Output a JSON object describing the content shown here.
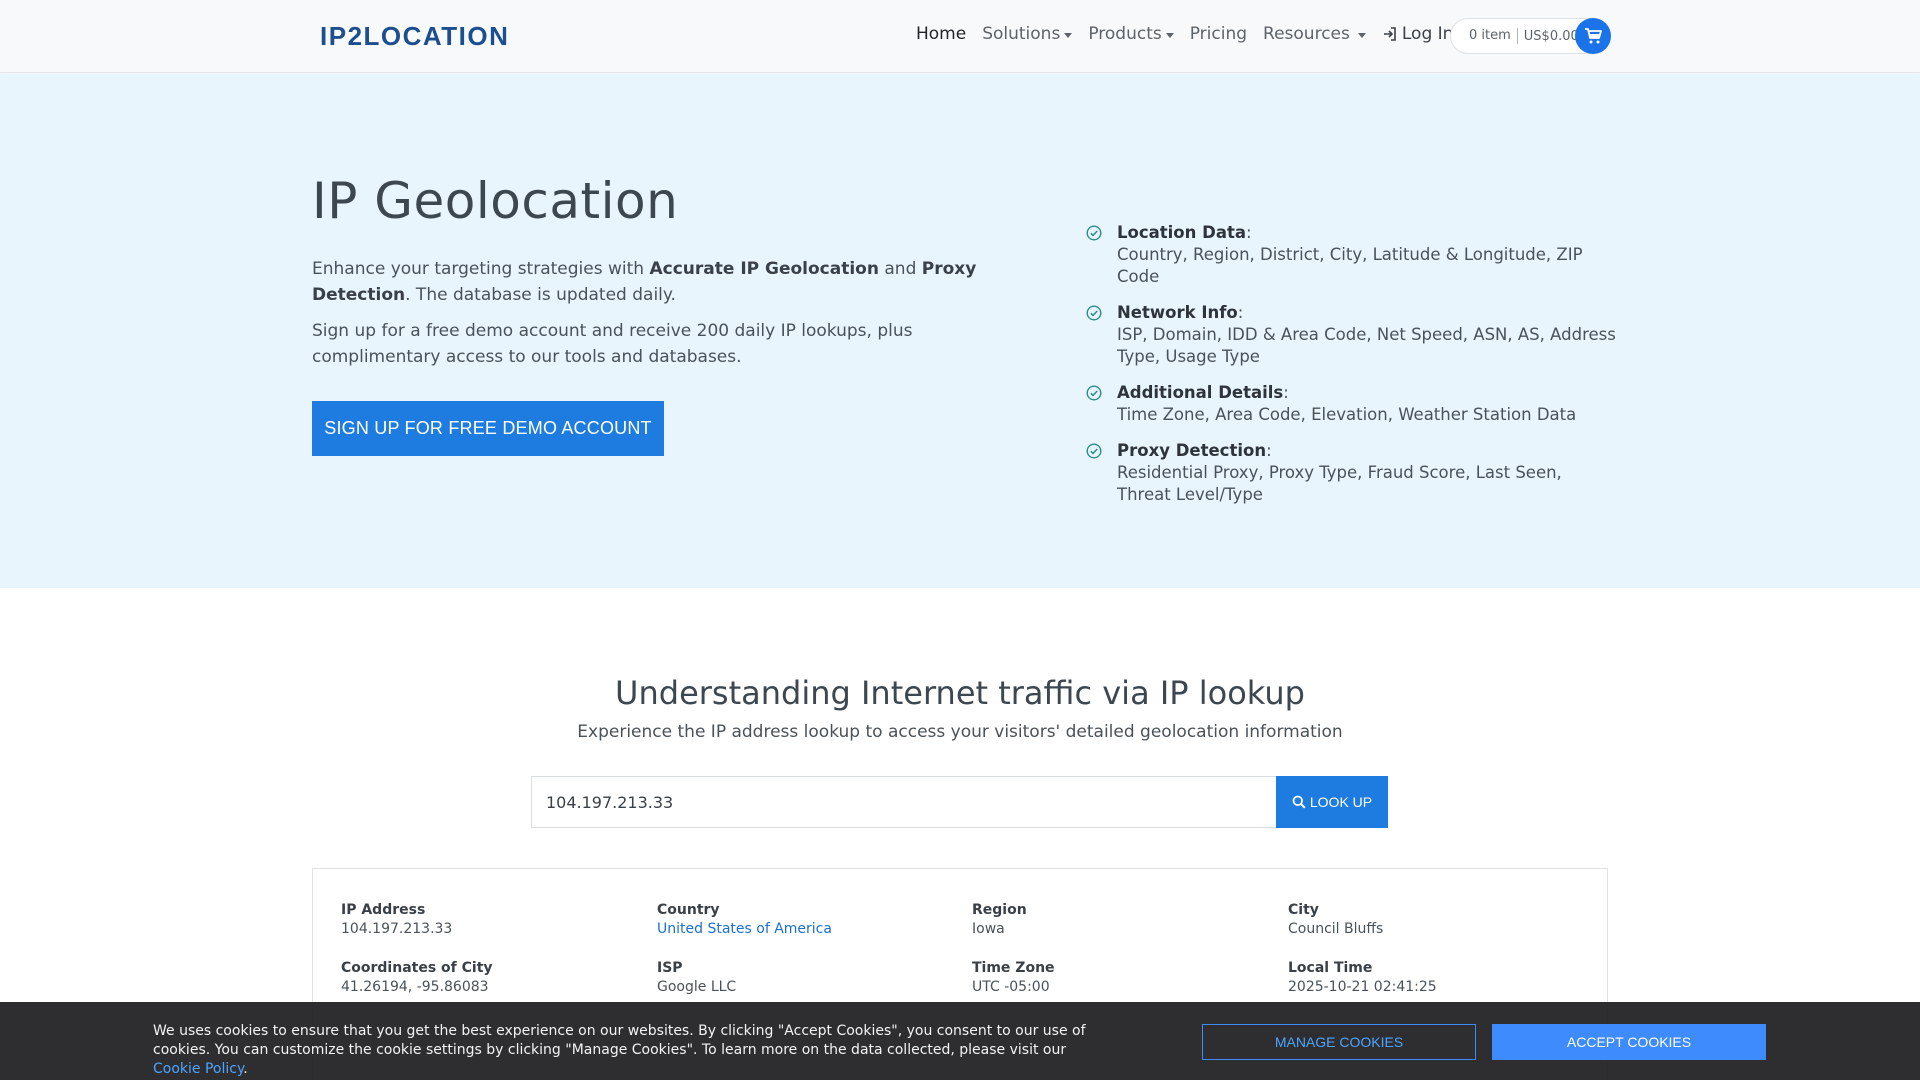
{
  "header": {
    "logo_text": "IP2LOCATION",
    "nav": [
      {
        "label": "Home"
      },
      {
        "label": "Solutions"
      },
      {
        "label": "Products"
      },
      {
        "label": "Pricing"
      },
      {
        "label": "Resources"
      },
      {
        "label": "Log In"
      }
    ],
    "cart": {
      "items": "0 item",
      "total": "US$0.00"
    }
  },
  "hero": {
    "title": "IP Geolocation",
    "p1_a": "Enhance your targeting strategies with ",
    "p1_b1": "Accurate IP Geolocation",
    "p1_c": " and ",
    "p1_b2": "Proxy Detection",
    "p1_d": ". The database is updated daily.",
    "p2": "Sign up for a free demo account and receive 200 daily IP lookups, plus complimentary access to our tools and databases.",
    "cta": "SIGN UP FOR FREE DEMO ACCOUNT"
  },
  "features": [
    {
      "title": "Location Data",
      "desc": "Country, Region, District, City, Latitude & Longitude, ZIP Code"
    },
    {
      "title": "Network Info",
      "desc": "ISP, Domain, IDD & Area Code, Net Speed, ASN, AS, Address Type, Usage Type"
    },
    {
      "title": "Additional Details",
      "desc": "Time Zone, Area Code, Elevation, Weather Station Data"
    },
    {
      "title": "Proxy Detection",
      "desc": "Residential Proxy, Proxy Type, Fraud Score, Last Seen, Threat Level/Type"
    }
  ],
  "lookup": {
    "title": "Understanding Internet traffic via IP lookup",
    "subtitle": "Experience the IP address lookup to access your visitors' detailed geolocation information",
    "input_value": "104.197.213.33",
    "button": "LOOK UP"
  },
  "results": [
    {
      "label": "IP Address",
      "value": "104.197.213.33"
    },
    {
      "label": "Country",
      "value": "United States of America"
    },
    {
      "label": "Region",
      "value": "Iowa"
    },
    {
      "label": "City",
      "value": "Council Bluffs"
    },
    {
      "label": "Coordinates of City",
      "value": "41.26194, -95.86083"
    },
    {
      "label": "ISP",
      "value": "Google LLC"
    },
    {
      "label": "Time Zone",
      "value": "UTC -05:00"
    },
    {
      "label": "Local Time",
      "value": "2025-10-21 02:41:25"
    }
  ],
  "cookie": {
    "text": "We uses cookies to ensure that you get the best experience on our websites. By clicking \"Accept Cookies\", you consent to our use of cookies. You can customize the cookie settings by clicking \"Manage Cookies\". To learn more on the data collected, please visit our ",
    "link": "Cookie Policy",
    "end": ".",
    "manage": "MANAGE COOKIES",
    "accept": "ACCEPT COOKIES"
  }
}
